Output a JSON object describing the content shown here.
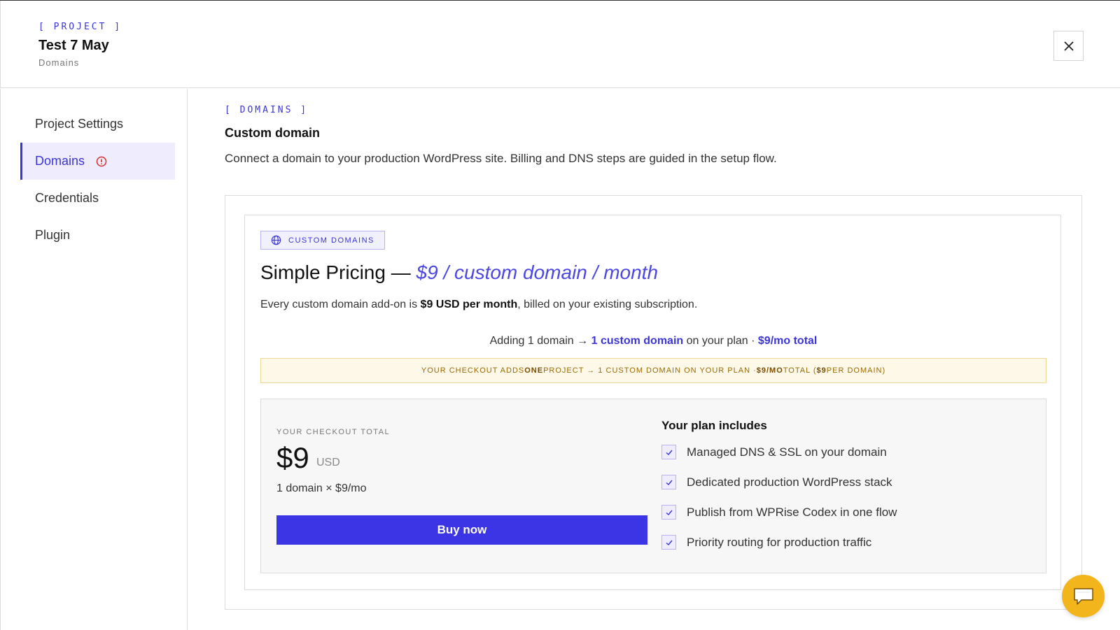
{
  "header": {
    "eyebrow": "[ PROJECT ]",
    "title": "Test 7 May",
    "subtitle": "Domains"
  },
  "sidebar": {
    "items": [
      {
        "label": "Project Settings",
        "active": false
      },
      {
        "label": "Domains",
        "active": true,
        "icon": "alert-circle-icon"
      },
      {
        "label": "Credentials",
        "active": false
      },
      {
        "label": "Plugin",
        "active": false
      }
    ]
  },
  "main": {
    "eyebrow": "[ DOMAINS ]",
    "title": "Custom domain",
    "description": "Connect a domain to your production WordPress site. Billing and DNS steps are guided in the setup flow."
  },
  "pricing": {
    "badge": "CUSTOM DOMAINS",
    "title_prefix": "Simple Pricing — ",
    "title_accent": "$9 / custom domain / month",
    "line_prefix": "Every custom domain add-on is ",
    "line_bold": "$9 USD per month",
    "line_suffix": ", billed on your existing subscription.",
    "adding_prefix": "Adding 1 domain → ",
    "adding_accent": "1 custom domain",
    "adding_middle": " on your plan · ",
    "adding_total": "$9/mo total",
    "notice_prefix": "YOUR CHECKOUT ADDS ",
    "notice_bold1": "ONE",
    "notice_middle": " PROJECT → 1 CUSTOM DOMAIN ON YOUR PLAN · ",
    "notice_bold2": "$9/MO",
    "notice_middle2": " TOTAL (",
    "notice_bold3": "$9",
    "notice_suffix": " PER DOMAIN)"
  },
  "checkout": {
    "label": "YOUR CHECKOUT TOTAL",
    "amount": "$9",
    "currency": "USD",
    "rate": "1 domain × $9/mo",
    "button": "Buy now"
  },
  "includes": {
    "title": "Your plan includes",
    "items": [
      "Managed DNS & SSL on your domain",
      "Dedicated production WordPress stack",
      "Publish from WPRise Codex in one flow",
      "Priority routing for production traffic"
    ]
  },
  "colors": {
    "accent": "#3b35d8",
    "button": "#3b35e6",
    "notice_bg": "#fdf8e8",
    "notice_text": "#9a6a06",
    "chat_fab": "#f2b51c",
    "alert": "#d0302a"
  },
  "icons": {
    "close": "close-icon",
    "badge": "globe-icon",
    "check": "check-icon",
    "chat": "chat-icon"
  }
}
